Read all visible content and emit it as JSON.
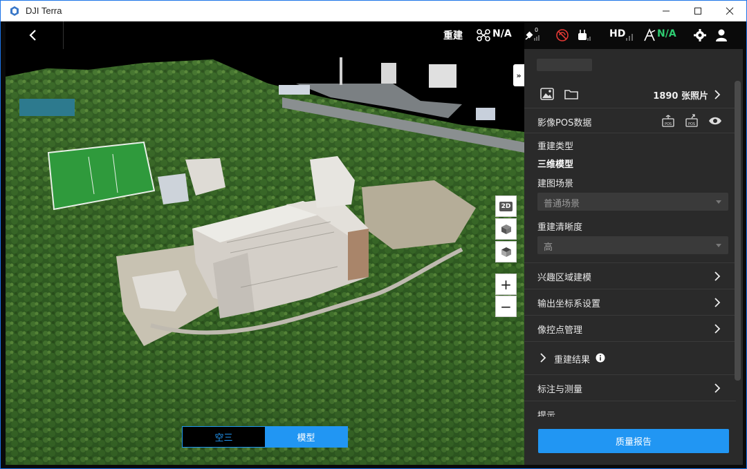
{
  "app": {
    "title": "DJI Terra",
    "brand_color": "#2196f3"
  },
  "window_controls": {
    "minimize": "—",
    "maximize": "☐",
    "close": "✕"
  },
  "topbar": {
    "mode_label": "重建",
    "drone_status": "N/A",
    "gps_signal_label": "0",
    "hd_label": "HD",
    "rtk_status": "N/A",
    "rtk_color": "#2ecc71",
    "icons": [
      "back-icon",
      "drone-icon",
      "satellite-icon",
      "signal-off-icon",
      "controller-icon",
      "hd-icon",
      "rtk-icon",
      "gear-icon",
      "user-icon"
    ]
  },
  "viewport": {
    "collapse_label": "»",
    "tools": {
      "two_d": "2D",
      "zoom_in": "+",
      "zoom_out": "−"
    },
    "toggle": {
      "aerial": "空三",
      "model": "模型"
    }
  },
  "panel": {
    "photos_count": "1890 张照片",
    "pos_section": "影像POS数据",
    "reconstruction_type_label": "重建类型",
    "reconstruction_type_value": "三维模型",
    "scene_label": "建图场景",
    "scene_value": "普通场景",
    "clarity_label": "重建清晰度",
    "clarity_value": "高",
    "rows": [
      {
        "label": "兴趣区域建模"
      },
      {
        "label": "输出坐标系设置"
      },
      {
        "label": "像控点管理"
      },
      {
        "label": "重建结果"
      },
      {
        "label": "标注与测量"
      },
      {
        "label": "提示"
      }
    ],
    "quality_button": "质量报告"
  }
}
